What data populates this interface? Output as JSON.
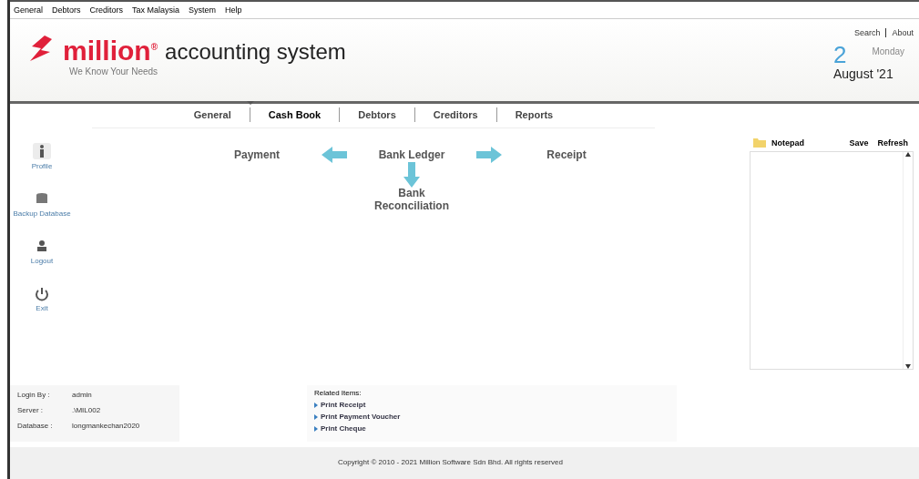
{
  "menu_bar": [
    "General",
    "Debtors",
    "Creditors",
    "Tax Malaysia",
    "System",
    "Help"
  ],
  "header": {
    "brand": "million",
    "brand_mark": "®",
    "product": "accounting system",
    "tagline": "We Know Your Needs",
    "links": [
      "Search",
      "About"
    ],
    "day_number": "2",
    "weekday": "Monday",
    "month_year": "August '21"
  },
  "tabs": [
    {
      "label": "General",
      "selected": false
    },
    {
      "label": "Cash Book",
      "selected": true
    },
    {
      "label": "Debtors",
      "selected": false
    },
    {
      "label": "Creditors",
      "selected": false
    },
    {
      "label": "Reports",
      "selected": false
    }
  ],
  "sidebar": {
    "items": [
      {
        "label": "Profile",
        "kind": "profile"
      },
      {
        "label": "Backup Database",
        "kind": "backup"
      },
      {
        "label": "Logout",
        "kind": "logout"
      },
      {
        "label": "Exit",
        "kind": "exit"
      }
    ]
  },
  "flow": {
    "left": "Payment",
    "center": "Bank Ledger",
    "right": "Receipt",
    "below": "Bank Reconciliation"
  },
  "notepad": {
    "title": "Notepad",
    "buttons": [
      "Save",
      "Refresh"
    ]
  },
  "session": [
    {
      "label": "Login By :",
      "value": "admin"
    },
    {
      "label": "Server :",
      "value": ".\\MIL002"
    },
    {
      "label": "Database :",
      "value": "longmankechan2020"
    }
  ],
  "related": {
    "title": "Related Items:",
    "items": [
      "Print Receipt",
      "Print Payment Voucher",
      "Print Cheque"
    ]
  },
  "footer": "Copyright © 2010 - 2021 Million Software Sdn Bhd. All rights reserved"
}
